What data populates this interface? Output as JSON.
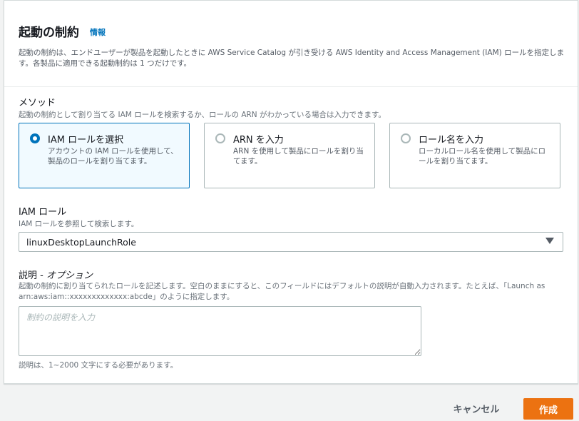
{
  "header": {
    "title": "起動の制約",
    "info_link": "情報",
    "description": "起動の制約は、エンドユーザーが製品を起動したときに AWS Service Catalog が引き受ける AWS Identity and Access Management (IAM) ロールを指定します。各製品に適用できる起動制約は 1 つだけです。"
  },
  "method": {
    "label": "メソッド",
    "description": "起動の制約として割り当てる IAM ロールを検索するか、ロールの ARN がわかっている場合は入力できます。",
    "options": [
      {
        "title": "IAM ロールを選択",
        "description": "アカウントの IAM ロールを使用して、製品のロールを割り当てます。",
        "selected": true
      },
      {
        "title": "ARN を入力",
        "description": "ARN を使用して製品にロールを割り当てます。",
        "selected": false
      },
      {
        "title": "ロール名を入力",
        "description": "ローカルロール名を使用して製品にロールを割り当てます。",
        "selected": false
      }
    ]
  },
  "iam_role": {
    "label": "IAM ロール",
    "description": "IAM ロールを参照して検索します。",
    "selected_value": "linuxDesktopLaunchRole"
  },
  "desc_field": {
    "label": "説明 - ",
    "label_optional": "オプション",
    "description": "起動の制約に割り当てられたロールを記述します。空白のままにすると、このフィールドにはデフォルトの説明が自動入力されます。たとえば、「Launch as arn:aws:iam::xxxxxxxxxxxxx:abcde」のように指定します。",
    "value": "",
    "placeholder": "制約の説明を入力",
    "constraint": "説明は、1~2000 文字にする必要があります。"
  },
  "footer": {
    "cancel_label": "キャンセル",
    "create_label": "作成"
  },
  "colors": {
    "accent": "#0073bb",
    "primary_button": "#ec7211"
  }
}
